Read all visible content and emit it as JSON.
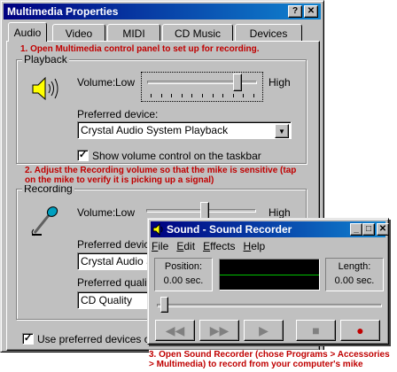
{
  "window": {
    "title": "Multimedia Properties",
    "help_btn": "?",
    "close_btn": "✕"
  },
  "tabs": [
    "Audio",
    "Video",
    "MIDI",
    "CD Music",
    "Devices"
  ],
  "annotations": {
    "step1": "1. Open Multimedia control panel to set up for recording.",
    "step2": "2. Adjust the Recording volume so that the mike is sensitive (tap on the mike to verify it is picking up a signal)",
    "step3_line1": "3. Open Sound Recorder (chose Programs > Accessories",
    "step3_line2": "> Multimedia) to record from your computer's mike"
  },
  "playback": {
    "group_label": "Playback",
    "volume_label": "Volume:",
    "low": "Low",
    "high": "High",
    "volume_level": 0.85,
    "device_label": "Preferred device:",
    "device_value": "Crystal Audio System Playback",
    "show_volume_label": "Show volume control on the taskbar",
    "show_volume_checked": "✓"
  },
  "recording": {
    "group_label": "Recording",
    "volume_label": "Volume:",
    "low": "Low",
    "high": "High",
    "volume_level": 0.55,
    "device_label": "Preferred device",
    "device_value": "Crystal Audio Sy",
    "quality_label": "Preferred quality:",
    "quality_value": "CD Quality"
  },
  "use_preferred": {
    "label": "Use preferred devices onl",
    "checked": "✓"
  },
  "recorder": {
    "title": "Sound - Sound Recorder",
    "menu": [
      "File",
      "Edit",
      "Effects",
      "Help"
    ],
    "position_label": "Position:",
    "position_value": "0.00 sec.",
    "length_label": "Length:",
    "length_value": "0.00 sec.",
    "buttons": [
      "◀◀",
      "▶▶",
      "▶",
      "■",
      "●"
    ],
    "record_color": "#c00000"
  }
}
